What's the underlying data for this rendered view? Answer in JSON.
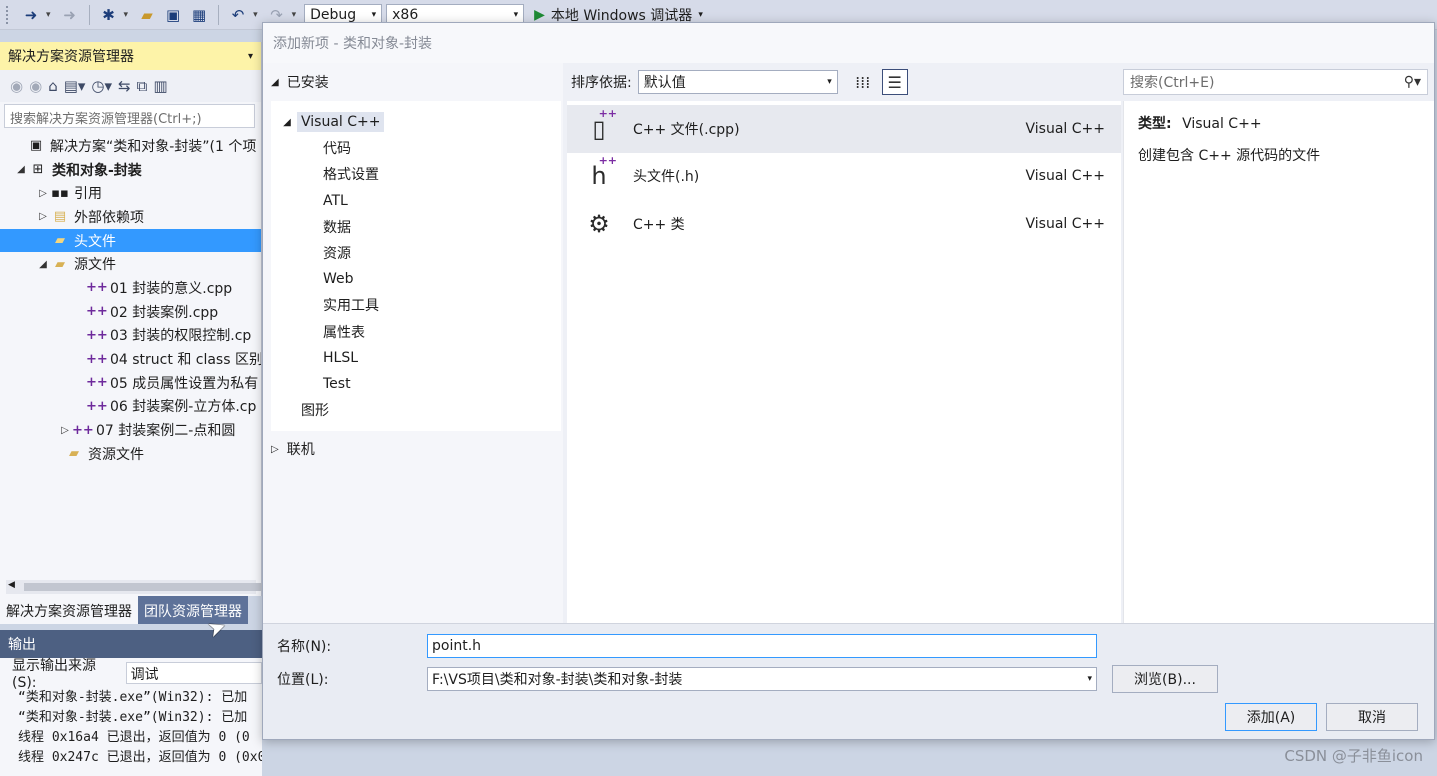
{
  "toolbar": {
    "config": "Debug",
    "platform": "x86",
    "run_label": "本地 Windows 调试器",
    "icons": [
      "back-icon",
      "forward-icon",
      "new-project-icon",
      "open-icon",
      "save-icon",
      "save-all-icon",
      "undo-icon",
      "redo-icon"
    ]
  },
  "solution_explorer": {
    "title": "解决方案资源管理器",
    "search_placeholder": "搜索解决方案资源管理器(Ctrl+;)",
    "tree": [
      {
        "label": "解决方案“类和对象-封装”(1 个项",
        "icon": "solution-icon"
      },
      {
        "label": "类和对象-封装",
        "icon": "project-icon"
      },
      {
        "label": "引用",
        "icon": "references-icon"
      },
      {
        "label": "外部依赖项",
        "icon": "external-deps-icon"
      },
      {
        "label": "头文件",
        "icon": "folder-icon"
      },
      {
        "label": "源文件",
        "icon": "folder-icon"
      },
      {
        "label": "01 封装的意义.cpp",
        "icon": "cpp-file-icon"
      },
      {
        "label": "02 封装案例.cpp",
        "icon": "cpp-file-icon"
      },
      {
        "label": "03 封装的权限控制.cp",
        "icon": "cpp-file-icon"
      },
      {
        "label": "04 struct 和 class 区别",
        "icon": "cpp-file-icon"
      },
      {
        "label": "05 成员属性设置为私有",
        "icon": "cpp-file-icon"
      },
      {
        "label": "06 封装案例-立方体.cp",
        "icon": "cpp-file-icon"
      },
      {
        "label": "07 封装案例二-点和圆",
        "icon": "cpp-file-icon"
      },
      {
        "label": "资源文件",
        "icon": "folder-icon"
      }
    ],
    "tabs": [
      "解决方案资源管理器",
      "团队资源管理器"
    ]
  },
  "output": {
    "title": "输出",
    "source_label": "显示输出来源(S):",
    "source_value": "调试",
    "lines": [
      "“类和对象-封装.exe”(Win32): 已加",
      "“类和对象-封装.exe”(Win32): 已加",
      "线程 0x16a4 已退出，返回值为 0 (0",
      "线程 0x247c 已退出，返回值为 0 (0x0)."
    ]
  },
  "dialog": {
    "title": "添加新项 - 类和对象-封装",
    "installed_label": "已安装",
    "categories": [
      {
        "label": "Visual C++",
        "level": 0
      },
      {
        "label": "代码",
        "level": 1
      },
      {
        "label": "格式设置",
        "level": 1
      },
      {
        "label": "ATL",
        "level": 1
      },
      {
        "label": "数据",
        "level": 1
      },
      {
        "label": "资源",
        "level": 1
      },
      {
        "label": "Web",
        "level": 1
      },
      {
        "label": "实用工具",
        "level": 1
      },
      {
        "label": "属性表",
        "level": 1
      },
      {
        "label": "HLSL",
        "level": 1
      },
      {
        "label": "Test",
        "level": 1
      },
      {
        "label": "图形",
        "level": 0
      }
    ],
    "online_label": "联机",
    "sort_label": "排序依据:",
    "sort_value": "默认值",
    "search_placeholder": "搜索(Ctrl+E)",
    "items": [
      {
        "name": "C++ 文件(.cpp)",
        "type": "Visual C++"
      },
      {
        "name": "头文件(.h)",
        "type": "Visual C++"
      },
      {
        "name": "C++ 类",
        "type": "Visual C++"
      }
    ],
    "description": {
      "type_key": "类型:",
      "type_value": "Visual C++",
      "text": "创建包含 C++ 源代码的文件"
    },
    "name_label": "名称(N):",
    "name_value": "point.h",
    "location_label": "位置(L):",
    "location_value": "F:\\VS项目\\类和对象-封装\\类和对象-封装",
    "browse_label": "浏览(B)...",
    "add_label": "添加(A)",
    "cancel_label": "取消"
  },
  "watermark": "CSDN @子非鱼icon"
}
